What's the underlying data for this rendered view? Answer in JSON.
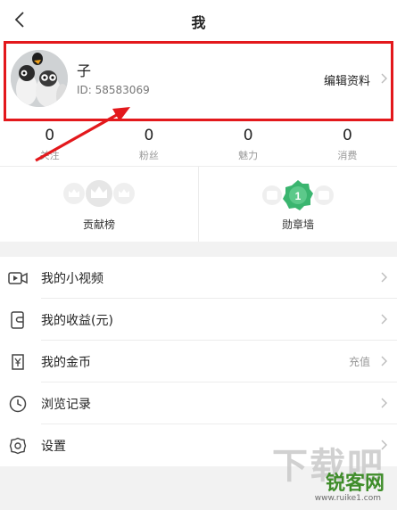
{
  "header": {
    "title": "我",
    "back_icon": "chevron-left-icon"
  },
  "profile": {
    "name": "子",
    "id_text": "ID: 58583069",
    "edit_label": "编辑资料"
  },
  "stats": [
    {
      "value": "0",
      "label": "关注"
    },
    {
      "value": "0",
      "label": "粉丝"
    },
    {
      "value": "0",
      "label": "魅力"
    },
    {
      "value": "0",
      "label": "消费"
    }
  ],
  "boards": [
    {
      "label": "贡献榜",
      "icon": "crowns-icon"
    },
    {
      "label": "勋章墙",
      "icon": "medal-icon",
      "badge": "1"
    }
  ],
  "menu": [
    {
      "label": "我的小视频",
      "icon": "video-icon",
      "extra": ""
    },
    {
      "label": "我的收益(元)",
      "icon": "wallet-icon",
      "extra": ""
    },
    {
      "label": "我的金币",
      "icon": "coin-icon",
      "extra": "充值"
    },
    {
      "label": "浏览记录",
      "icon": "clock-icon",
      "extra": ""
    },
    {
      "label": "设置",
      "icon": "gear-icon",
      "extra": ""
    }
  ],
  "watermark": {
    "line1": "下载吧",
    "line2": "锐客网",
    "line3": "www.ruike1.com"
  },
  "colors": {
    "highlight": "#e3181c",
    "arrow": "#e3181c",
    "medal": "#3ab56f"
  }
}
